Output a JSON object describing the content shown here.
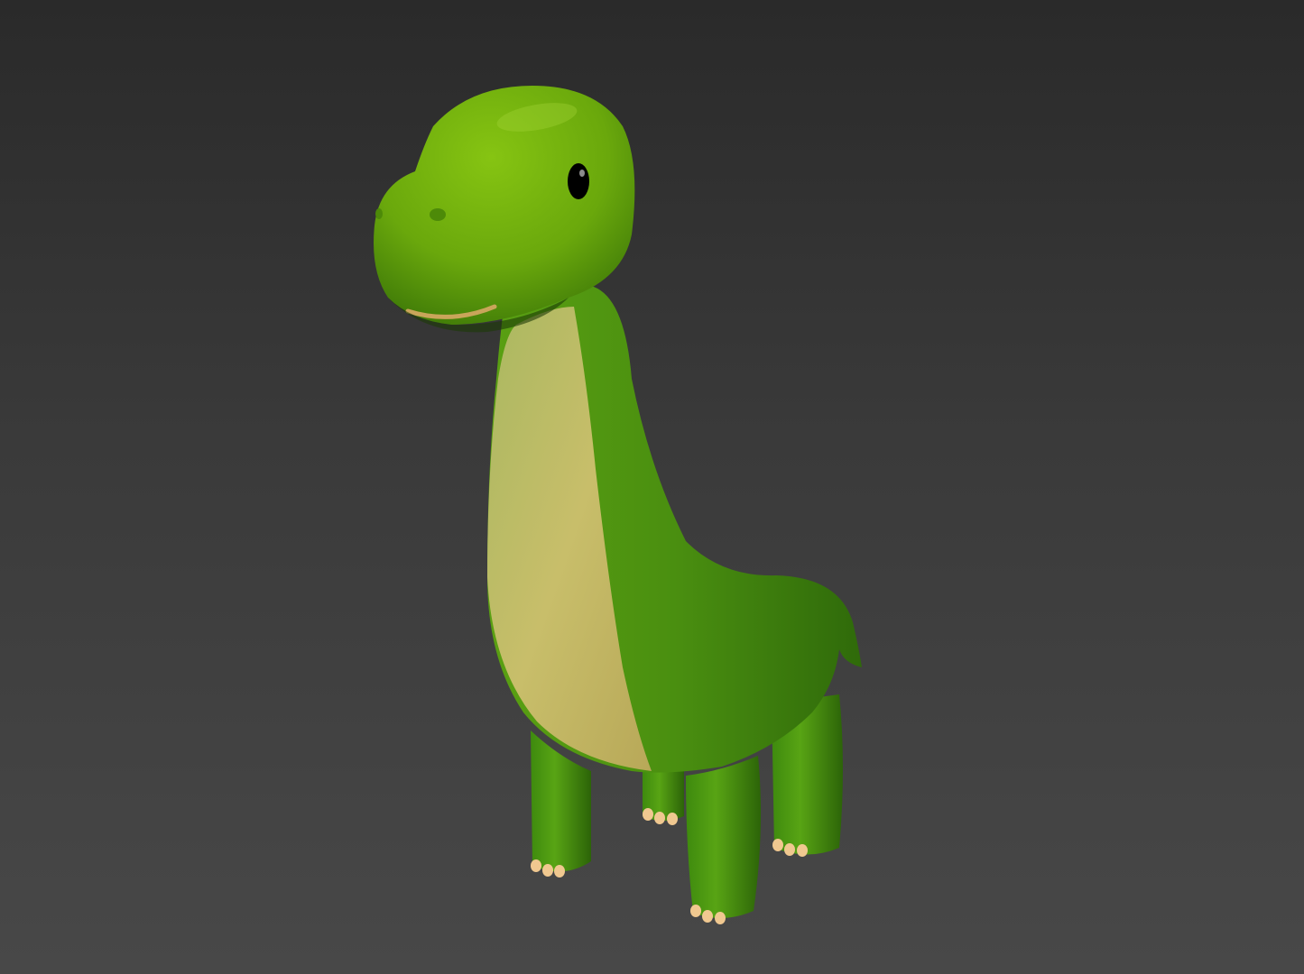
{
  "viewport": {
    "background_top": "#2a2a2a",
    "background_bottom": "#484848"
  },
  "model": {
    "subject": "cartoon-dinosaur",
    "body_color": "#4f9a12",
    "head_color": "#74b40a",
    "belly_color": "#c8bb6a",
    "toe_color": "#f0c890",
    "eye_color": "#000000",
    "mouth_color": "#c9a55a"
  }
}
